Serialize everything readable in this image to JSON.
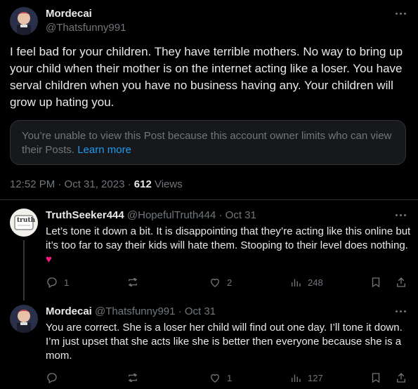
{
  "main_post": {
    "author_name": "Mordecai",
    "author_handle": "@Thatsfunny991",
    "text": "I feel bad for your children. They have terrible mothers. No way to bring up your child when their mother is on the internet acting like a loser. You have serval children when you have no business having any. Your children will grow up hating you.",
    "notice_text": "You’re unable to view this Post because this account owner limits who can view their Posts.",
    "notice_link": "Learn more",
    "time": "12:52 PM · Oct 31, 2023 · ",
    "views_count": "612",
    "views_label": " Views"
  },
  "replies": [
    {
      "author_name": "TruthSeeker444",
      "author_handle": "@HopefulTruth444 · Oct 31",
      "avatar_text": "truth",
      "text": "Let’s tone it down a bit. It is disappointing that they’re acting like this online but it’s too far to say their kids will hate them. Stooping to their level does nothing.",
      "emoji": "♥",
      "reply_count": "1",
      "repost_count": "",
      "like_count": "2",
      "view_count": "248"
    },
    {
      "author_name": "Mordecai",
      "author_handle": "@Thatsfunny991 · Oct 31",
      "text": "You are correct. She is a loser her child will find out one day. I’ll tone it down. I’m just upset that she acts like she  is better then everyone because she is a mom.",
      "reply_count": "",
      "repost_count": "",
      "like_count": "1",
      "view_count": "127"
    }
  ],
  "colors": {
    "background": "#000000",
    "text": "#e7e9ea",
    "muted": "#71767b",
    "link": "#1d9bf0",
    "heart": "#f91880"
  }
}
